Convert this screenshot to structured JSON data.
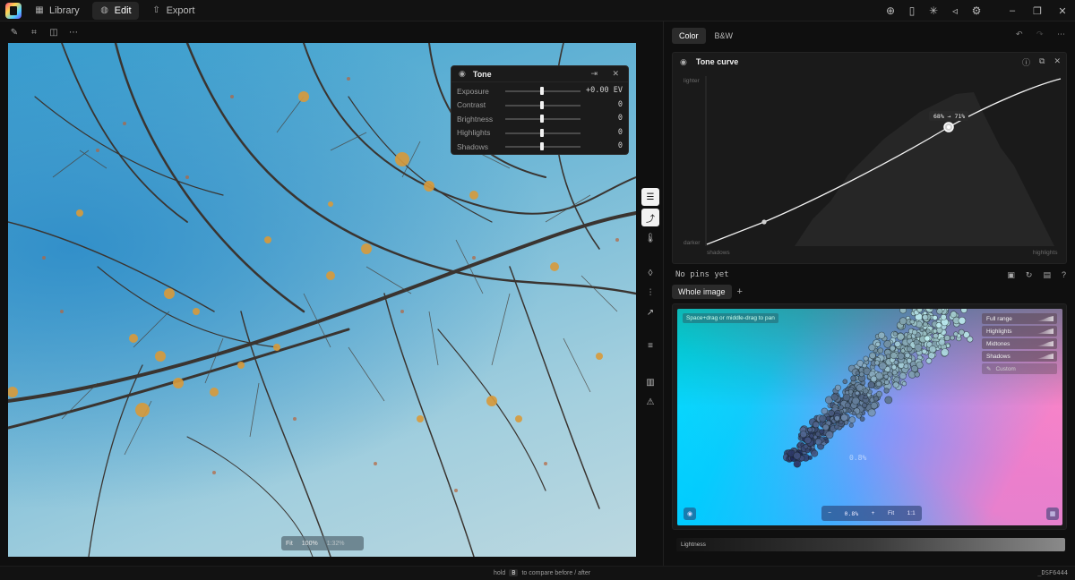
{
  "topbar": {
    "tabs": [
      {
        "label": "Library",
        "icon": "library-icon"
      },
      {
        "label": "Edit",
        "icon": "edit-palette-icon"
      },
      {
        "label": "Export",
        "icon": "export-icon"
      }
    ],
    "right_icons": [
      "globe-icon",
      "book-icon",
      "sparkle-icon",
      "megaphone-icon",
      "gear-icon"
    ],
    "window_buttons": [
      "minimize-icon",
      "restore-icon",
      "close-icon"
    ]
  },
  "tools": [
    "pin-tool-icon",
    "crop-icon",
    "compare-icon",
    "more-icon"
  ],
  "photo": {
    "zoom": {
      "fit": "Fit",
      "percent": "100%",
      "other": "1:32%"
    }
  },
  "tone_panel": {
    "title": "Tone",
    "rows": [
      {
        "label": "Exposure",
        "value": "+0.00 EV"
      },
      {
        "label": "Contrast",
        "value": "0"
      },
      {
        "label": "Brightness",
        "value": "0"
      },
      {
        "label": "Highlights",
        "value": "0"
      },
      {
        "label": "Shadows",
        "value": "0"
      }
    ]
  },
  "side_tools": [
    "sliders-icon",
    "curve-chart-icon",
    "thermometer-icon",
    "drop-icon",
    "equalizer-icon",
    "curve-tool-icon",
    "levels-icon",
    "histogram-icon",
    "warning-icon"
  ],
  "mode_tabs": {
    "color": "Color",
    "bw": "B&W"
  },
  "tone_curve": {
    "title": "Tone curve",
    "y_top": "lighter",
    "y_bottom": "darker",
    "x_left": "shadows",
    "x_right": "highlights",
    "pin_label": "68% → 71%"
  },
  "pins": {
    "text": "No pins yet"
  },
  "scope_tabs": {
    "whole": "Whole image",
    "add": "+"
  },
  "gamut": {
    "hint": "Space+drag or middle-drag to pan",
    "center_label": "0.8%",
    "ranges": [
      "Full range",
      "Highlights",
      "Midtones",
      "Shadows",
      "Custom"
    ],
    "bottom": {
      "minus": "−",
      "value": "0.8%",
      "plus": "+",
      "fit": "Fit",
      "ratio": "1:1"
    }
  },
  "lightness": {
    "label": "Lightness"
  },
  "status": {
    "hold": "hold",
    "key": "B",
    "compare": "to compare before / after",
    "filename": "_DSF6444"
  }
}
